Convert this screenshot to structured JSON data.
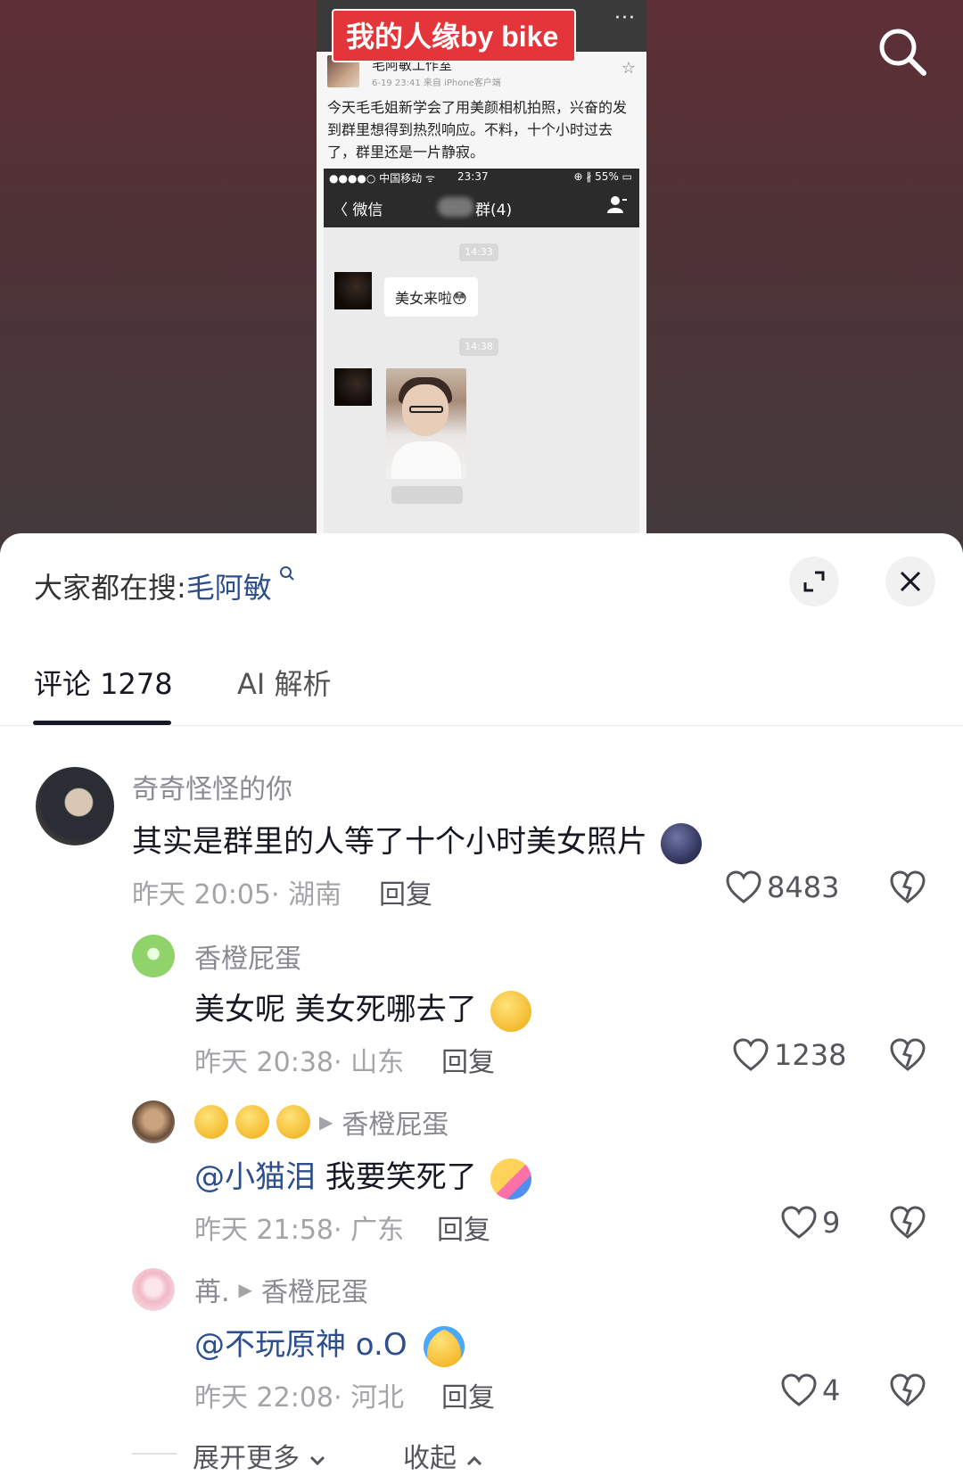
{
  "video": {
    "badge": "我的人缘by bike",
    "more_dots": "···",
    "weibo": {
      "account": "毛阿敏工作室",
      "meta": "6-19 23:41  来自 iPhone客户端",
      "text": "今天毛毛姐新学会了用美颜相机拍照，兴奋的发到群里想得到热烈响应。不料，十个小时过去了，群里还是一片静寂。"
    },
    "wechat": {
      "carrier": "●●●●○ 中国移动 ᯤ",
      "time": "23:37",
      "battery": "⊕ ∦ 55% ▭",
      "back": "〈 微信",
      "group": "群(4)",
      "time1": "14:33",
      "msg1": "美女来啦😳",
      "time2": "14:38"
    }
  },
  "sheet": {
    "search_prefix": "大家都在搜:",
    "search_keyword": "毛阿敏",
    "tabs": [
      {
        "label": "评论 1278"
      },
      {
        "label": "AI 解析"
      }
    ]
  },
  "comments": [
    {
      "user": "奇奇怪怪的你",
      "text": "其实是群里的人等了十个小时美女照片",
      "time": "昨天 20:05",
      "location": "湖南",
      "reply": "回复",
      "likes": "8483"
    },
    {
      "user": "香橙屁蛋",
      "text": "美女呢 美女死哪去了",
      "time": "昨天 20:38",
      "location": "山东",
      "reply": "回复",
      "likes": "1238"
    },
    {
      "user": "",
      "reply_to": "香橙屁蛋",
      "mention": "@小猫泪",
      "text": " 我要笑死了",
      "time": "昨天 21:58",
      "location": "广东",
      "reply": "回复",
      "likes": "9"
    },
    {
      "user": "苒.",
      "reply_to": "香橙屁蛋",
      "mention": "@不玩原神 o.O",
      "text": "",
      "time": "昨天 22:08",
      "location": "河北",
      "reply": "回复",
      "likes": "4"
    }
  ],
  "footer": {
    "expand": "展开更多",
    "collapse": "收起"
  },
  "colors": {
    "mention": "#2d4f8d",
    "muted": "#a3a4a8",
    "text": "#161823"
  }
}
